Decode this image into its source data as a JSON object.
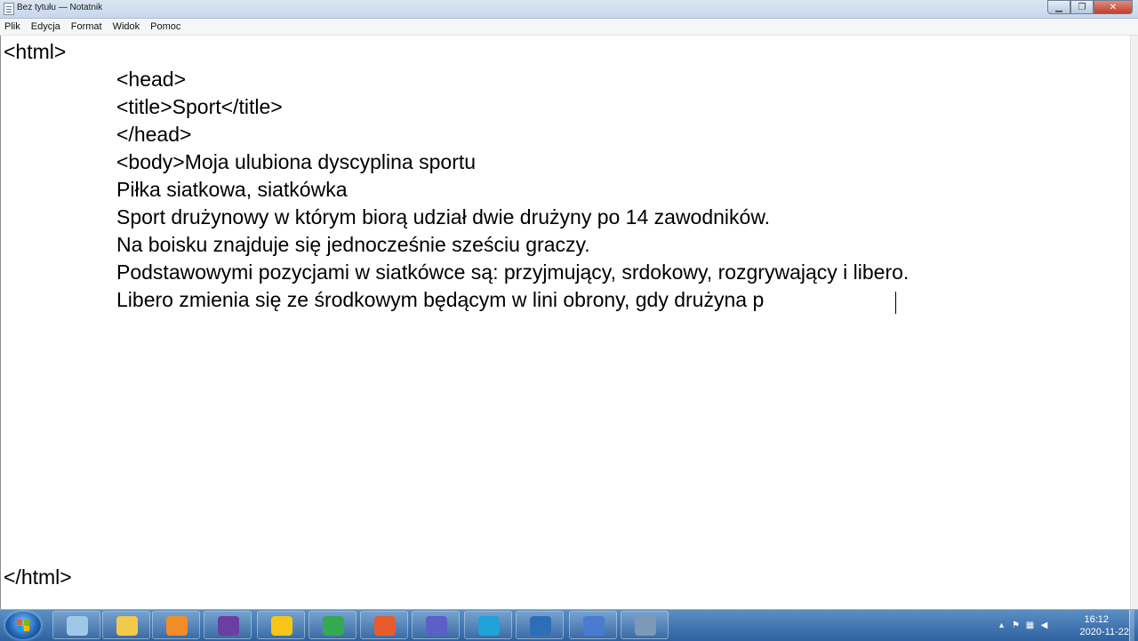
{
  "window": {
    "title": "Bez tytułu — Notatnik"
  },
  "menu": {
    "items": [
      "Plik",
      "Edycja",
      "Format",
      "Widok",
      "Pomoc"
    ]
  },
  "editor": {
    "lines": [
      "<html>",
      "<head>",
      "<title>Sport</title>",
      "</head>",
      "<body>Moja ulubiona dyscyplina sportu",
      "Piłka siatkowa, siatkówka",
      "Sport drużynowy w którym biorą udział dwie drużyny po 14 zawodników.",
      "Na boisku znajduje się jednocześnie sześciu graczy.",
      "Podstawowymi pozycjami w siatkówce są: przyjmujący, srdokowy, rozgrywający i libero.",
      "Libero zmienia się ze środkowym będącym w lini obrony, gdy drużyna p",
      "</html>"
    ]
  },
  "taskbar": {
    "apps": [
      {
        "icon": "windows-explorer-icon",
        "color": "#9fc8e8"
      },
      {
        "icon": "folder-icon",
        "color": "#f2c94c"
      },
      {
        "icon": "media-player-icon",
        "color": "#f28c28"
      },
      {
        "icon": "wizard-icon",
        "color": "#6b3fa0"
      },
      {
        "icon": "warning-app-icon",
        "color": "#f5c518"
      },
      {
        "icon": "chrome-icon",
        "color": "#34a853"
      },
      {
        "icon": "office-icon",
        "color": "#e65c2c"
      },
      {
        "icon": "teams-icon",
        "color": "#5b5fc7"
      },
      {
        "icon": "edge-icon",
        "color": "#1fa3d8"
      },
      {
        "icon": "snowflake-app-icon",
        "color": "#2d6fb7"
      },
      {
        "icon": "mt7-app-icon",
        "color": "#4a7bd1"
      },
      {
        "icon": "network-icon",
        "color": "#7c9ab8"
      }
    ],
    "clock": {
      "time": "16:12",
      "date": "2020-11-22"
    }
  }
}
